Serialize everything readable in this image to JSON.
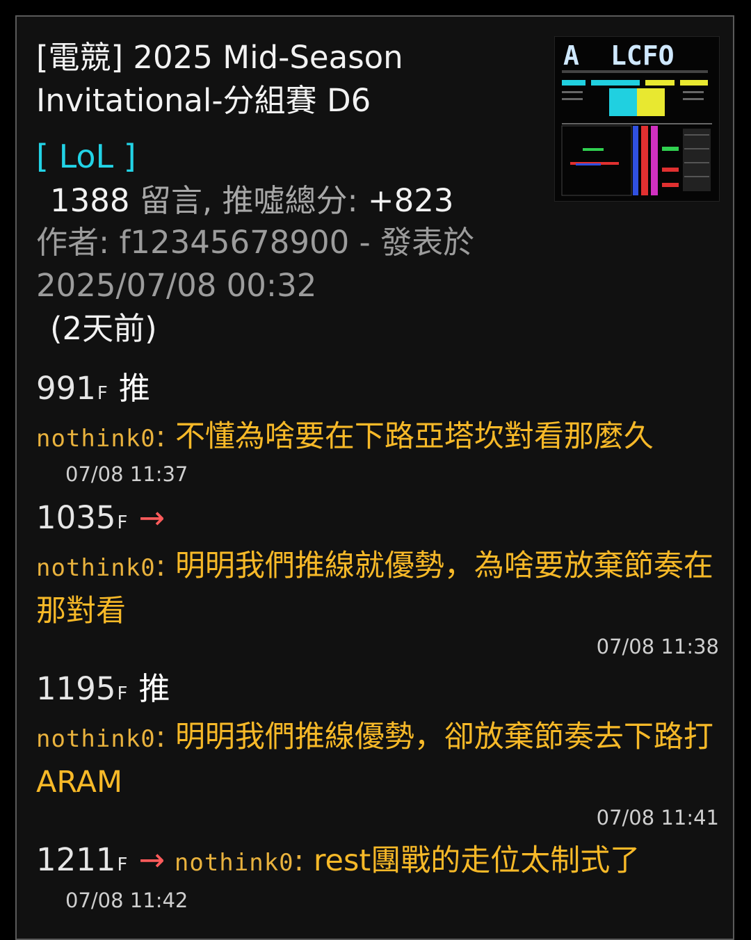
{
  "post": {
    "title": "[電競] 2025 Mid-Season Invitational-分組賽 D6",
    "board_tag": "[ LoL ]",
    "comment_count": "1388",
    "comment_label": " 留言, 推噓總分: ",
    "score": "+823",
    "author_line": "作者: f12345678900 - 發表於 2025/07/08 00:32",
    "relative_time": "(2天前)",
    "thumbnail_text": "LCFO"
  },
  "comments": [
    {
      "floor": "991",
      "floor_suffix": "F",
      "tag": "推",
      "user": "nothink0",
      "text": "不懂為啥要在下路亞塔坎對看那麼久",
      "time": "07/08 11:37"
    },
    {
      "floor": "1035",
      "floor_suffix": "F",
      "tag": "→",
      "user": "nothink0",
      "text": "明明我們推線就優勢，為啥要放棄節奏在那對看",
      "time": "07/08 11:38"
    },
    {
      "floor": "1195",
      "floor_suffix": "F",
      "tag": "推",
      "user": "nothink0",
      "text": "明明我們推線優勢，卻放棄節奏去下路打ARAM",
      "time": "07/08 11:41"
    },
    {
      "floor": "1211",
      "floor_suffix": "F",
      "tag": "→",
      "user": "nothink0",
      "text": "rest團戰的走位太制式了",
      "time": "07/08 11:42"
    }
  ],
  "colors": {
    "background": "#111111",
    "board_tag": "#22d3e6",
    "comment_text": "#f7b928",
    "arrow_tag": "#ff5b5b"
  }
}
